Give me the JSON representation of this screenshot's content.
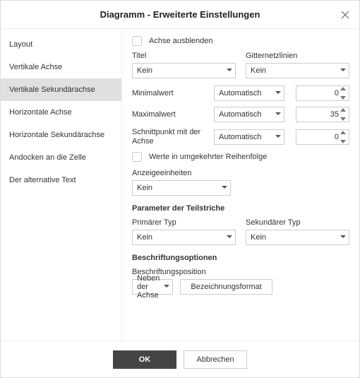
{
  "title": "Diagramm - Erweiterte Einstellungen",
  "sidebar": {
    "items": [
      {
        "label": "Layout"
      },
      {
        "label": "Vertikale Achse"
      },
      {
        "label": "Vertikale Sekundärachse"
      },
      {
        "label": "Horizontale Achse"
      },
      {
        "label": "Horizontale Sekundärachse"
      },
      {
        "label": "Andocken an die Zelle"
      },
      {
        "label": "Der alternative Text"
      }
    ],
    "selected_index": 2
  },
  "content": {
    "hide_axis_label": "Achse ausblenden",
    "title_label": "Titel",
    "title_value": "Kein",
    "gridlines_label": "Gitternetzlinien",
    "gridlines_value": "Kein",
    "min_label": "Minimalwert",
    "min_mode": "Automatisch",
    "min_value": "0",
    "max_label": "Maximalwert",
    "max_mode": "Automatisch",
    "max_value": "35",
    "cross_label": "Schnittpunkt mit der Achse",
    "cross_mode": "Automatisch",
    "cross_value": "0",
    "reverse_label": "Werte in umgekehrter Reihenfolge",
    "units_label": "Anzeigeeinheiten",
    "units_value": "Kein",
    "ticks_heading": "Parameter der Teilstriche",
    "primary_type_label": "Primärer Typ",
    "primary_type_value": "Kein",
    "secondary_type_label": "Sekundärer Typ",
    "secondary_type_value": "Kein",
    "label_heading": "Beschriftungsoptionen",
    "label_pos_label": "Beschriftungsposition",
    "label_pos_value": "Neben der Achse",
    "format_btn": "Bezeichnungsformat"
  },
  "buttons": {
    "ok": "OK",
    "cancel": "Abbrechen"
  }
}
